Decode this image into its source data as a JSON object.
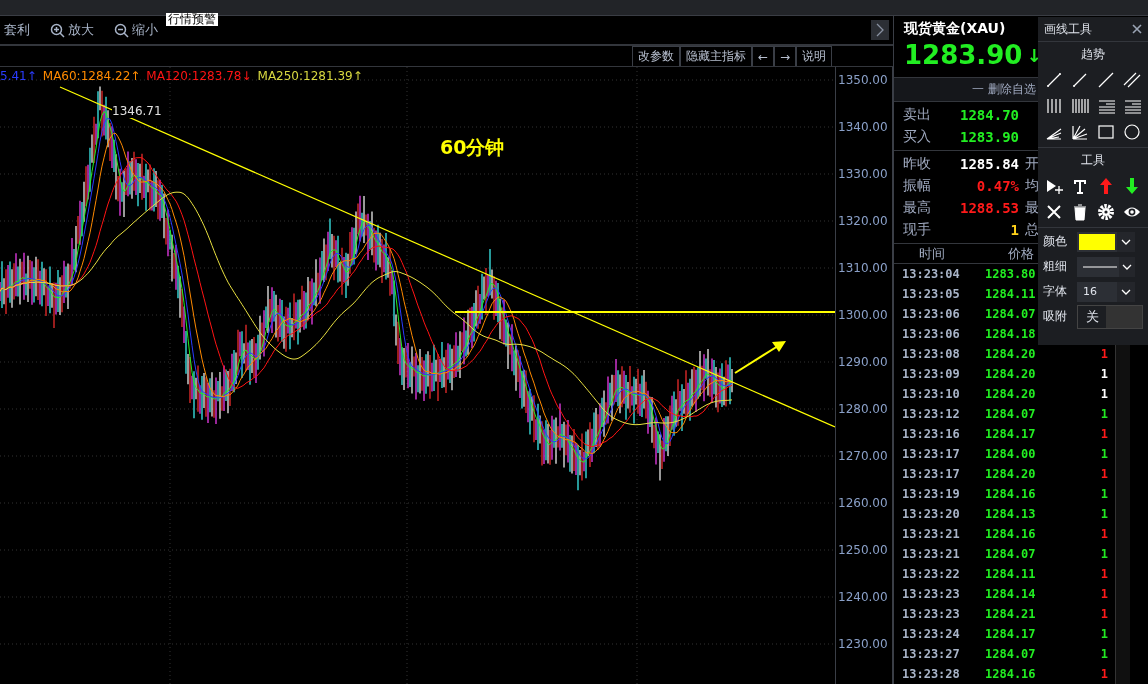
{
  "tooltip": "行情预警",
  "toolbar": [
    {
      "kind": "text",
      "label": "套利"
    },
    {
      "kind": "zoom_in",
      "label": "放大"
    },
    {
      "kind": "zoom_out",
      "label": "缩小"
    }
  ],
  "chart_buttons": [
    "改参数",
    "隐藏主指标",
    "←",
    "→",
    "说明"
  ],
  "legend": [
    {
      "label": "5.41↑",
      "color": "#2a3cff"
    },
    {
      "label": "MA60:1284.22↑",
      "color": "#ff8a00"
    },
    {
      "label": "MA120:1283.78↓",
      "color": "#ff1414"
    },
    {
      "label": "MA250:1281.39↑",
      "color": "#d8d840"
    }
  ],
  "chart": {
    "high_label": "1346.71",
    "period": "60分钟",
    "price_axis": [
      "1350.00",
      "1340.00",
      "1330.00",
      "1320.00",
      "1310.00",
      "1300.00",
      "1290.00",
      "1280.00",
      "1270.00",
      "1260.00",
      "1250.00",
      "1240.00",
      "1230.00"
    ]
  },
  "quote": {
    "title": "现货黄金(XAU)",
    "price": "1283.90",
    "arrow": "↓",
    "action": "一 删除自选",
    "bid_ask": [
      {
        "label": "卖出",
        "value": "1284.70"
      },
      {
        "label": "买入",
        "value": "1283.90"
      }
    ],
    "stats": [
      {
        "label": "昨收",
        "value": "1285.84",
        "color": "#ffffff",
        "label_2": "开"
      },
      {
        "label": "振幅",
        "value": "0.47%",
        "color": "#ff1a1a",
        "label_2": "均"
      },
      {
        "label": "最高",
        "value": "1288.53",
        "color": "#ff1a1a",
        "label_2": "最"
      },
      {
        "label": "现手",
        "value": "1",
        "color": "#ffd21a",
        "label_2": "总"
      }
    ]
  },
  "trades": {
    "columns": [
      "时间",
      "价格"
    ],
    "rows": [
      {
        "time": "13:23:04",
        "price": "1283.80"
      },
      {
        "time": "13:23:05",
        "price": "1284.11"
      },
      {
        "time": "13:23:06",
        "price": "1284.07"
      },
      {
        "time": "13:23:06",
        "price": "1284.18"
      },
      {
        "time": "13:23:08",
        "price": "1284.20",
        "volume": "1",
        "color": "#ff1a1a"
      },
      {
        "time": "13:23:09",
        "price": "1284.20",
        "volume": "1",
        "color": "#ffffff"
      },
      {
        "time": "13:23:10",
        "price": "1284.20",
        "volume": "1",
        "color": "#ffffff"
      },
      {
        "time": "13:23:12",
        "price": "1284.07",
        "volume": "1",
        "color": "#22e822"
      },
      {
        "time": "13:23:16",
        "price": "1284.17",
        "volume": "1",
        "color": "#ff1a1a"
      },
      {
        "time": "13:23:17",
        "price": "1284.00",
        "volume": "1",
        "color": "#22e822"
      },
      {
        "time": "13:23:17",
        "price": "1284.20",
        "volume": "1",
        "color": "#ff1a1a"
      },
      {
        "time": "13:23:19",
        "price": "1284.16",
        "volume": "1",
        "color": "#22e822"
      },
      {
        "time": "13:23:20",
        "price": "1284.13",
        "volume": "1",
        "color": "#22e822"
      },
      {
        "time": "13:23:21",
        "price": "1284.16",
        "volume": "1",
        "color": "#ff1a1a"
      },
      {
        "time": "13:23:21",
        "price": "1284.07",
        "volume": "1",
        "color": "#22e822"
      },
      {
        "time": "13:23:22",
        "price": "1284.11",
        "volume": "1",
        "color": "#ff1a1a"
      },
      {
        "time": "13:23:23",
        "price": "1284.14",
        "volume": "1",
        "color": "#ff1a1a"
      },
      {
        "time": "13:23:23",
        "price": "1284.21",
        "volume": "1",
        "color": "#ff1a1a"
      },
      {
        "time": "13:23:24",
        "price": "1284.17",
        "volume": "1",
        "color": "#22e822"
      },
      {
        "time": "13:23:27",
        "price": "1284.07",
        "volume": "1",
        "color": "#22e822"
      },
      {
        "time": "13:23:28",
        "price": "1284.16",
        "volume": "1",
        "color": "#ff1a1a"
      }
    ]
  },
  "drawing_tools": {
    "title": "画线工具",
    "trend_heading": "趋势",
    "tool_heading": "工具",
    "settings": [
      {
        "kind": "color",
        "label": "颜色",
        "color": "#ffff00"
      },
      {
        "kind": "line",
        "label": "粗细"
      },
      {
        "kind": "select",
        "label": "字体",
        "value": "16"
      },
      {
        "kind": "toggle",
        "label": "吸附",
        "value": "关",
        "on": false
      }
    ]
  }
}
